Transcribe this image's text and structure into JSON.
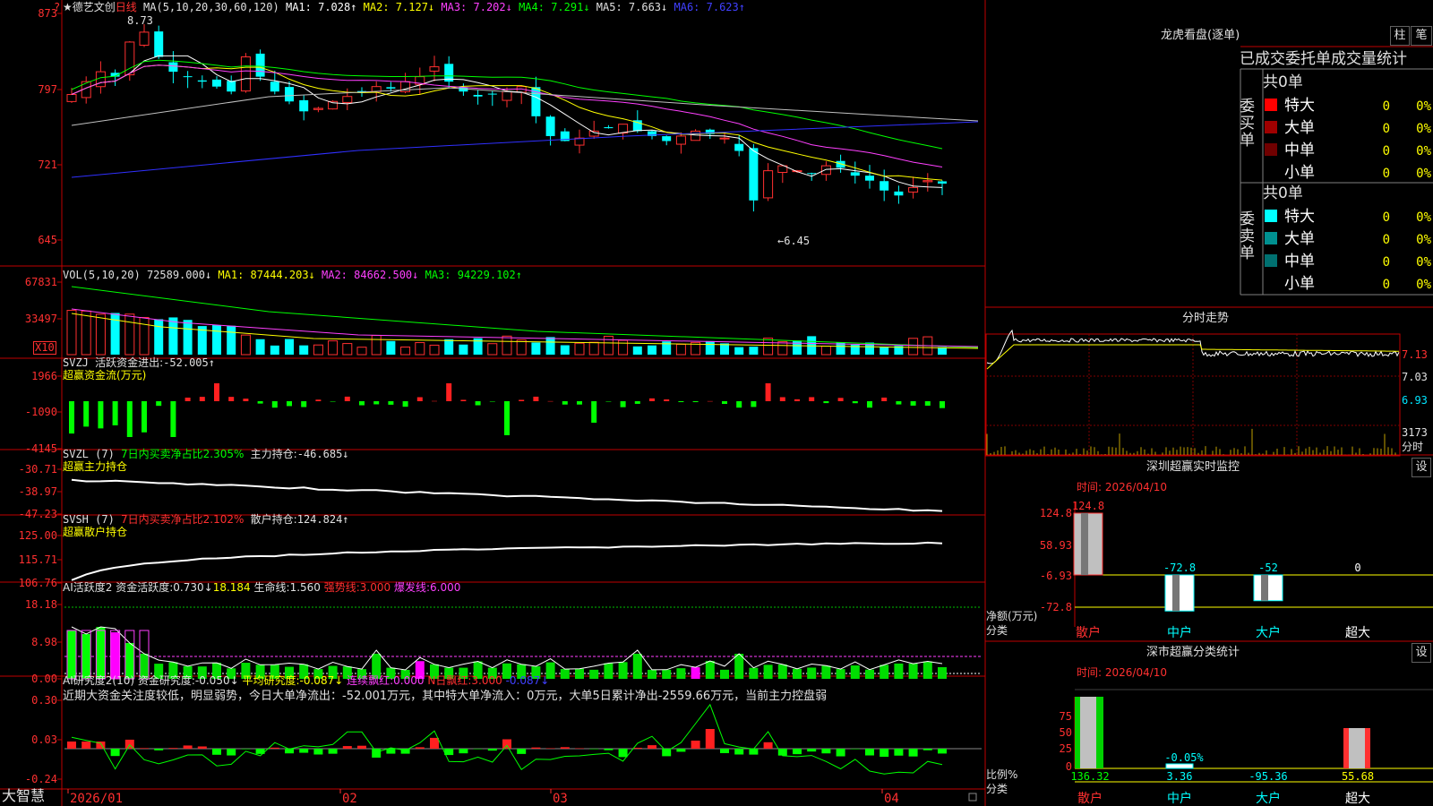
{
  "app": {
    "bottom_brand": "大智慧"
  },
  "price_panel": {
    "title": "★德艺文创",
    "period": "日线",
    "ma_label": "MA(5,10,20,30,60,120)",
    "ma": [
      {
        "k": "MA1:",
        "v": "7.028↑",
        "color": "#ffffff"
      },
      {
        "k": "MA2:",
        "v": "7.127↓",
        "color": "#ffff00"
      },
      {
        "k": "MA3:",
        "v": "7.202↓",
        "color": "#ff40ff"
      },
      {
        "k": "MA4:",
        "v": "7.291↓",
        "color": "#00ff00"
      },
      {
        "k": "MA5:",
        "v": "7.663↓",
        "color": "#e0e0e0"
      },
      {
        "k": "MA6:",
        "v": "7.623↑",
        "color": "#4040ff"
      }
    ],
    "yticks": [
      "873",
      "797",
      "721",
      "645"
    ],
    "high_label": "8.73",
    "low_label": "←6.45"
  },
  "vol_panel": {
    "label": "VOL(5,10,20)",
    "value": "72589.000↓",
    "ma": [
      {
        "k": "MA1:",
        "v": "87444.203↓",
        "color": "#ffff00"
      },
      {
        "k": "MA2:",
        "v": "84662.500↓",
        "color": "#ff40ff"
      },
      {
        "k": "MA3:",
        "v": "94229.102↑",
        "color": "#00ff00"
      }
    ],
    "yticks": [
      "67831",
      "33497"
    ],
    "unit": "X10"
  },
  "svzj_panel": {
    "label": "SVZJ",
    "k": "活跃资金进出:",
    "v": "-52.005↑",
    "sub": "超赢资金流(万元)",
    "yticks": [
      "1966",
      "-1090",
      "-4145"
    ]
  },
  "svzl_panel": {
    "label": "SVZL (7)",
    "desc": "7日内买卖净占比2.305%",
    "k": "主力持仓:",
    "v": "-46.685↓",
    "sub": "超赢主力持仓",
    "yticks": [
      "-30.71",
      "-38.97",
      "-47.23"
    ]
  },
  "svsh_panel": {
    "label": "SVSH (7)",
    "desc": "7日内买卖净占比2.102%",
    "k": "散户持仓:",
    "v": "124.824↑",
    "sub": "超赢散户持仓",
    "yticks": [
      "125.00",
      "115.71",
      "106.76"
    ]
  },
  "ai1_panel": {
    "label": "AI活跃度2",
    "k1": "资金活跃度:",
    "v1": "0.730↓",
    "v2": "18.184",
    "k3": "生命线:",
    "v3": "1.560",
    "k4": "强势线:",
    "v4": "3.000",
    "k5": "爆发线:",
    "v5": "6.000",
    "yticks": [
      "18.18",
      "8.98",
      "0.00"
    ]
  },
  "ai2_panel": {
    "label": "AI研究度2(10)",
    "k1": "资金研究度:",
    "v1": "-0.050↓",
    "k2": "平均研究度:",
    "v2": "-0.087↓",
    "k3": "连续飘红:",
    "v3": "0.000",
    "k4": "N日飘红:",
    "v4": "3.000",
    "v5": "-0.087↓",
    "comment": "近期大资金关注度较低，明显弱势，今日大单净流出：-52.001万元，其中特大单净流入：0万元，大单5日累计净出-2559.66万元，当前主力控盘弱",
    "yticks": [
      "0.30",
      "0.03",
      "-0.24"
    ]
  },
  "xaxis": [
    "2026/01",
    "02",
    "03",
    "04"
  ],
  "lhb": {
    "title": "龙虎看盘(逐单)",
    "btn1": "柱",
    "btn2": "笔",
    "subtitle": "已成交委托单成交量统计",
    "buy_side": "委买单",
    "sell_side": "委卖单",
    "buy_total": "共0单",
    "sell_total": "共0单",
    "buy_rows": [
      {
        "name": "特大",
        "count": "0",
        "pct": "0%",
        "color": "#ff0000"
      },
      {
        "name": "大单",
        "count": "0",
        "pct": "0%",
        "color": "#a00000"
      },
      {
        "name": "中单",
        "count": "0",
        "pct": "0%",
        "color": "#700000"
      },
      {
        "name": "小单",
        "count": "0",
        "pct": "0%",
        "color": "#000000"
      }
    ],
    "sell_rows": [
      {
        "name": "特大",
        "count": "0",
        "pct": "0%",
        "color": "#00ffff"
      },
      {
        "name": "大单",
        "count": "0",
        "pct": "0%",
        "color": "#009090"
      },
      {
        "name": "中单",
        "count": "0",
        "pct": "0%",
        "color": "#007070"
      },
      {
        "name": "小单",
        "count": "0",
        "pct": "0%",
        "color": "#000000"
      }
    ]
  },
  "intraday": {
    "title": "分时走势",
    "yticks": [
      "7.13",
      "7.03",
      "6.93"
    ],
    "vol_max": "3173",
    "vol_unit": "分时"
  },
  "sz_monitor": {
    "title": "深圳超赢实时监控",
    "btn": "设",
    "time": "时间: 2026/04/10",
    "yticks": [
      "124.8",
      "58.93",
      "-6.93",
      "-72.8"
    ],
    "ylabel": "净额(万元)",
    "xlabel": "分类",
    "cats": [
      "散户",
      "中户",
      "大户",
      "超大"
    ],
    "values": [
      "124.8",
      "-72.8",
      "-52",
      "0"
    ]
  },
  "sz_stats": {
    "title": "深市超赢分类统计",
    "btn": "设",
    "time": "时间: 2026/04/10",
    "yticks": [
      "75",
      "50",
      "25",
      "0"
    ],
    "ylabel": "比例%",
    "xlabel": "分类",
    "cats": [
      "散户",
      "中户",
      "大户",
      "超大"
    ],
    "values": [
      "136.32",
      "3.36",
      "-95.36",
      "55.68"
    ],
    "extra": "-0.05%"
  }
}
